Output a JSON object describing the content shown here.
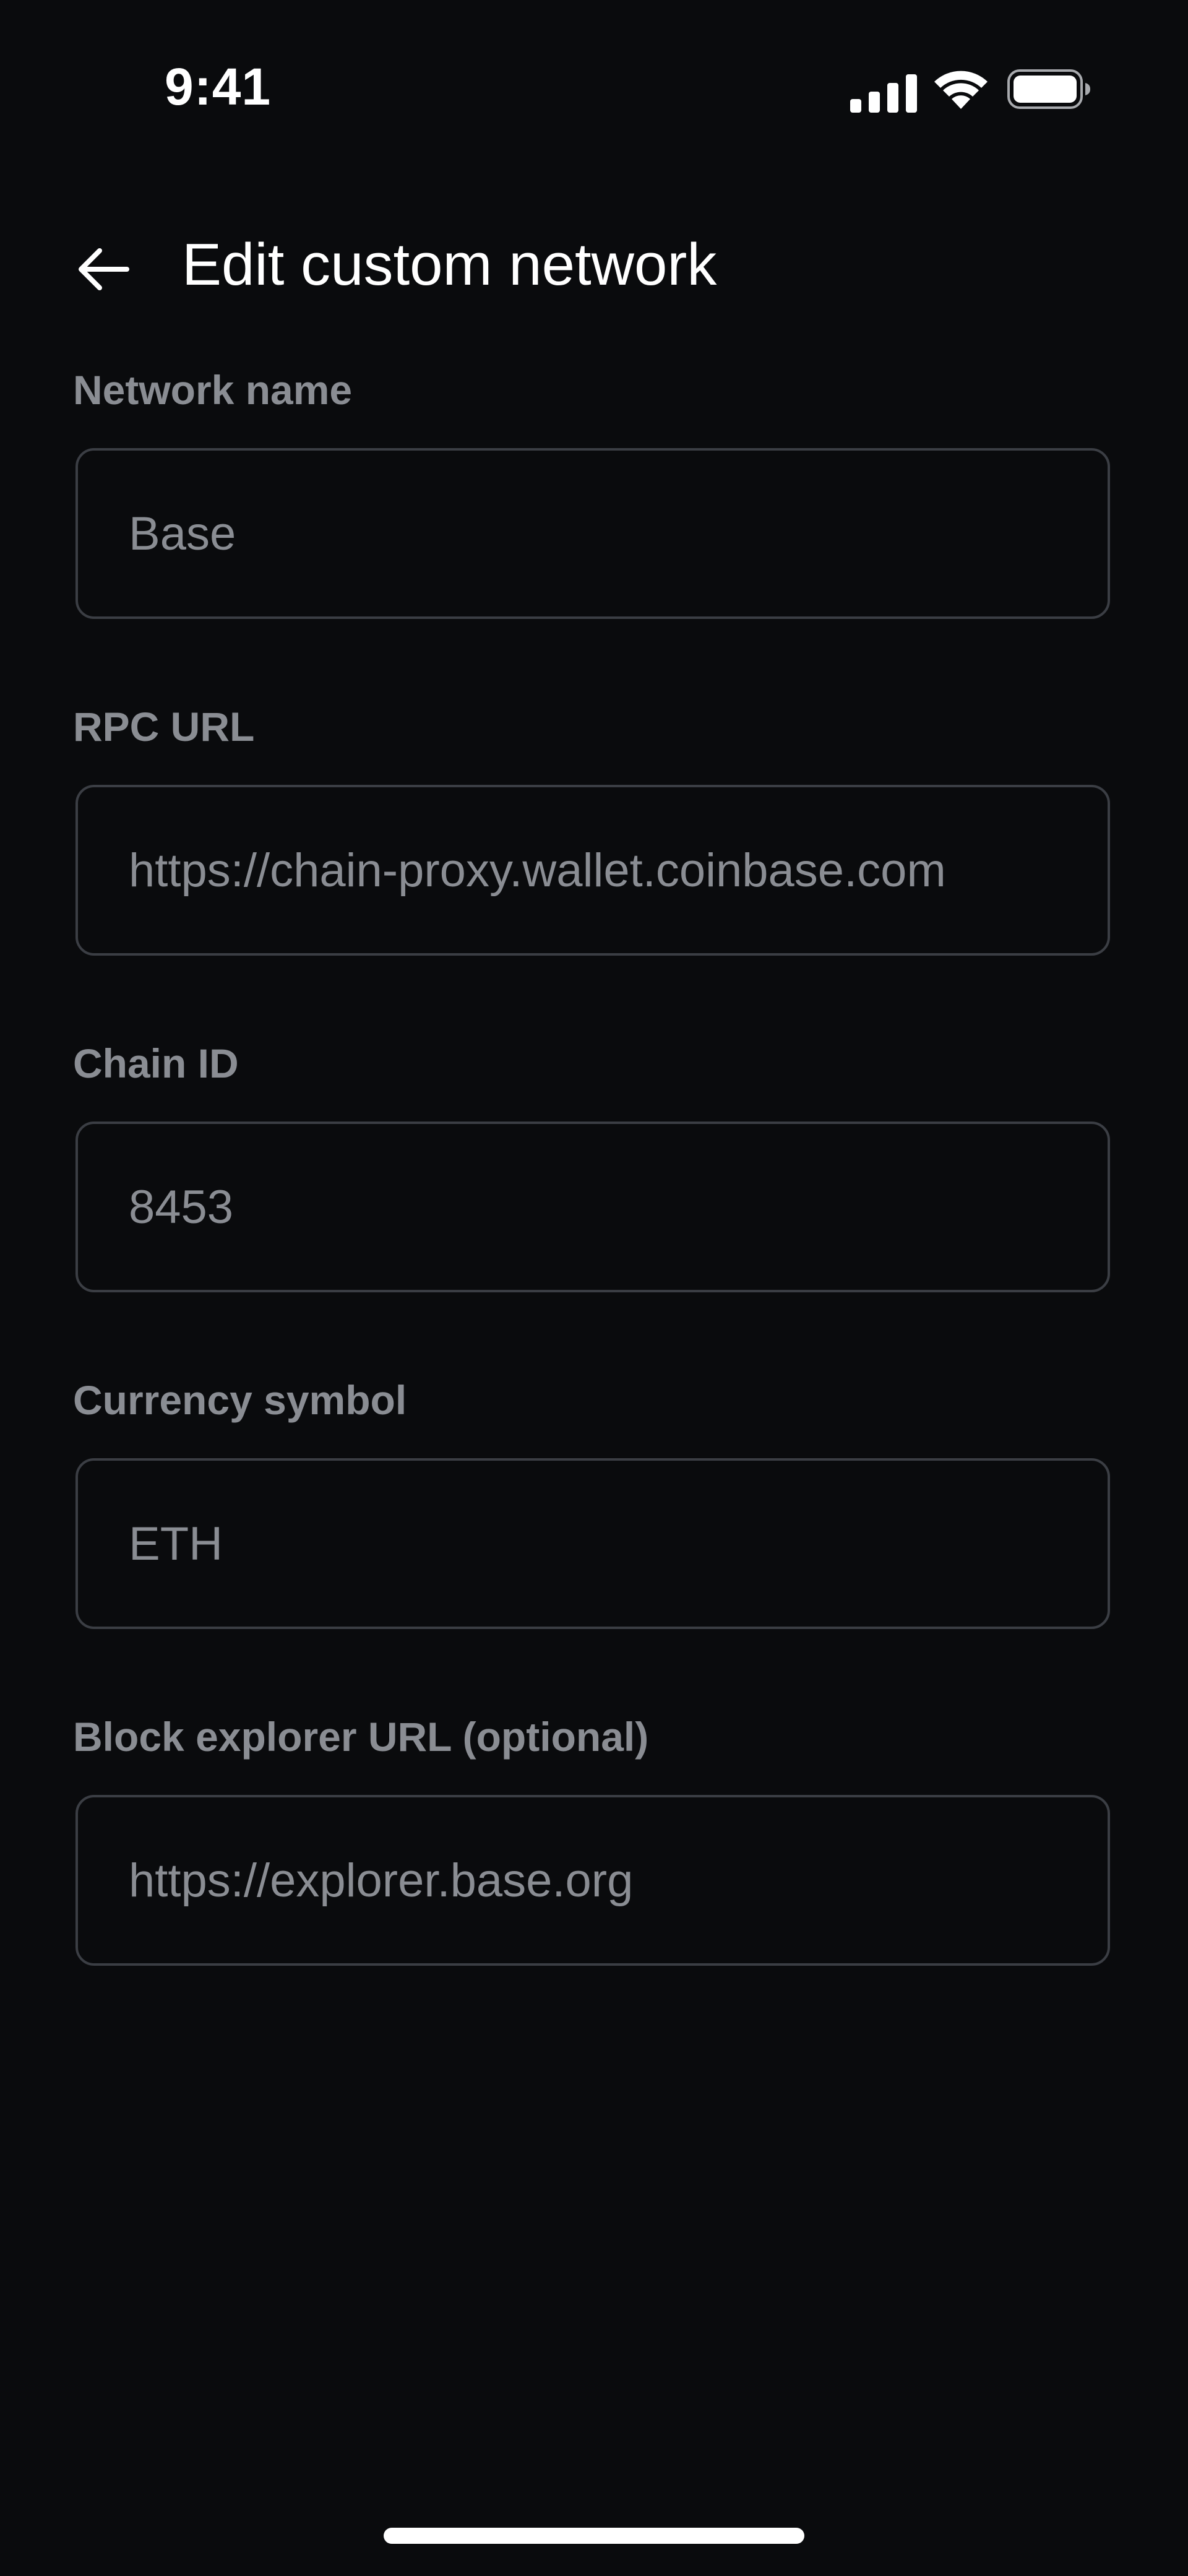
{
  "status_bar": {
    "time": "9:41",
    "icons": [
      "cellular-signal-icon",
      "wifi-icon",
      "battery-icon"
    ]
  },
  "header": {
    "back_icon": "arrow-left-icon",
    "title": "Edit custom network"
  },
  "form": {
    "fields": [
      {
        "label": "Network name",
        "value": "Base"
      },
      {
        "label": "RPC URL",
        "value": "https://chain-proxy.wallet.coinbase.com"
      },
      {
        "label": "Chain ID",
        "value": "8453"
      },
      {
        "label": "Currency symbol",
        "value": "ETH"
      },
      {
        "label": "Block explorer URL (optional)",
        "value": "https://explorer.base.org"
      }
    ]
  },
  "colors": {
    "background": "#0a0b0d",
    "text_primary": "#ffffff",
    "text_secondary": "#8a8d93",
    "field_border": "#3b3e44"
  }
}
